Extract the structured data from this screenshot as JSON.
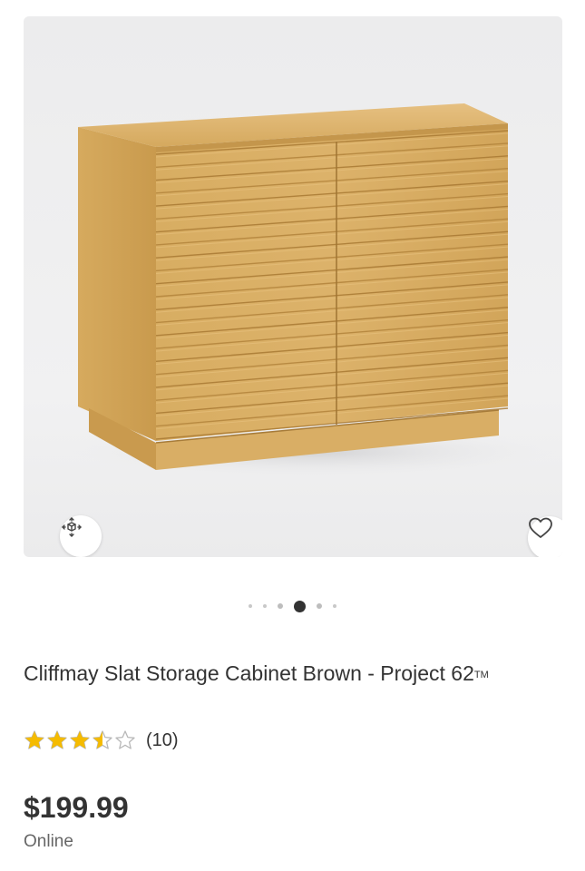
{
  "product": {
    "title": "Cliffmay Slat Storage Cabinet Brown - Project 62",
    "trademark": "TM",
    "rating": 3.5,
    "rating_max": 5,
    "review_count": "(10)",
    "price": "$199.99",
    "availability": "Online"
  },
  "gallery": {
    "image_count": 6,
    "active_index": 3,
    "ar_icon": "ar-view-icon",
    "favorite_icon": "heart-outline-icon"
  },
  "colors": {
    "star_filled": "#f5bb00",
    "star_empty": "#b8b8b8",
    "wood_light": "#d9ad62",
    "wood_dark": "#b98a3e",
    "active_dot": "#333333"
  }
}
